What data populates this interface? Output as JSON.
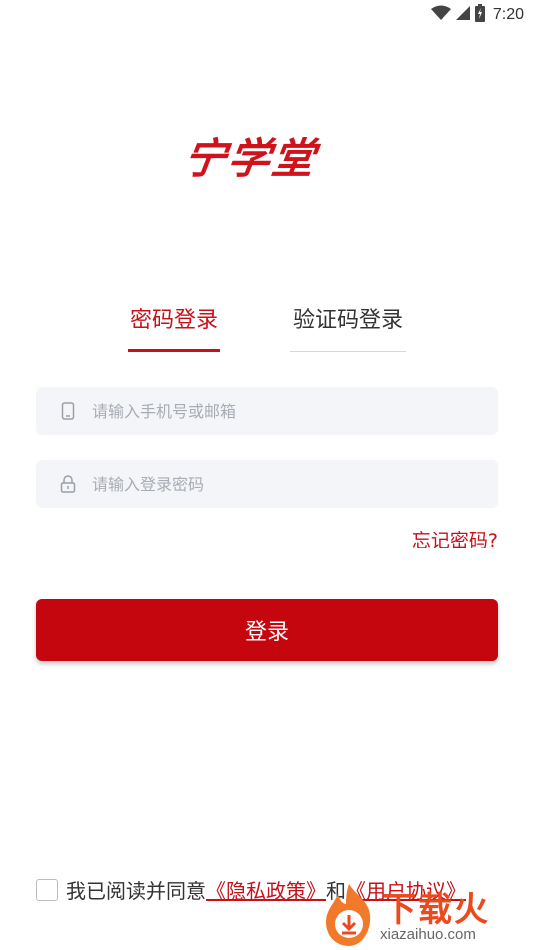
{
  "status_bar": {
    "time": "7:20",
    "icons": [
      "wifi-icon",
      "signal-icon",
      "battery-icon"
    ]
  },
  "logo": {
    "text": "宁学堂",
    "color": "#d0121b"
  },
  "tabs": [
    {
      "label": "密码登录",
      "active": true
    },
    {
      "label": "验证码登录",
      "active": false
    }
  ],
  "phone_field": {
    "placeholder": "请输入手机号或邮箱",
    "value": "",
    "icon": "phone-icon"
  },
  "password_field": {
    "placeholder": "请输入登录密码",
    "value": "",
    "icon": "lock-icon"
  },
  "forgot_password": "忘记密码?",
  "login_button": "登录",
  "agreement": {
    "checked": false,
    "prefix": "我已阅读并同意",
    "privacy_link": "《隐私政策》",
    "conjunction": "和",
    "user_link": "《用户协议》"
  },
  "watermark": {
    "title": "下载火",
    "site": "xiazaihuo.com"
  },
  "colors": {
    "accent": "#c8101a",
    "button": "#c6060f",
    "field_bg": "#f4f5f8"
  }
}
